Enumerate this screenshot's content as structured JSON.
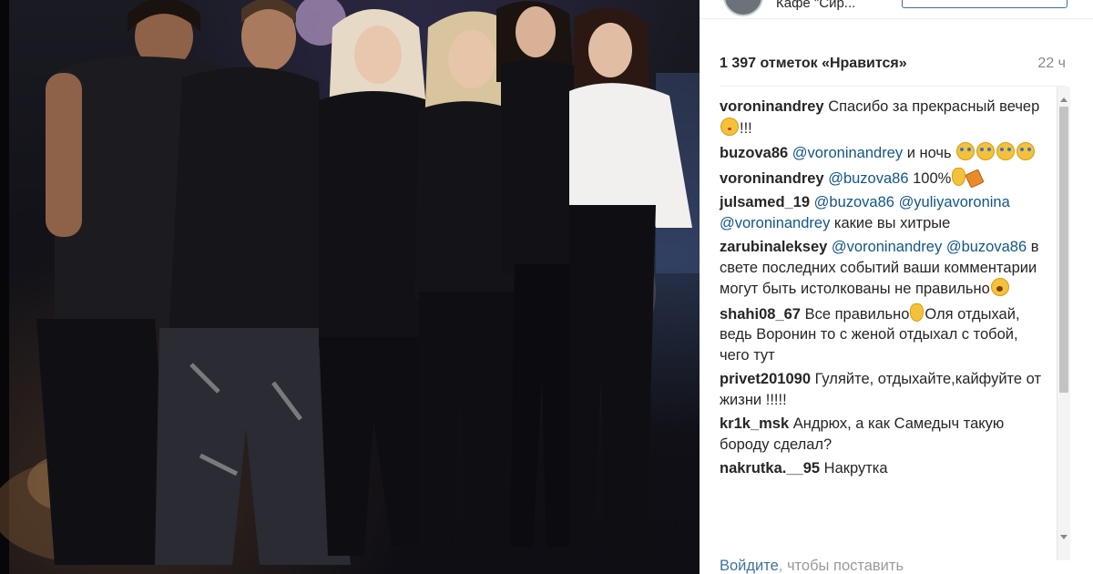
{
  "post": {
    "location": "Кафе \"Сир...",
    "likes_text": "1 397 отметок «Нравится»",
    "time_ago": "22 ч"
  },
  "comments": [
    {
      "user": "voroninandrey",
      "parts": [
        {
          "t": "text",
          "v": "Спасибо за прекрасный вечер"
        },
        {
          "t": "emoji",
          "v": "kiss"
        },
        {
          "t": "text",
          "v": "!!!"
        }
      ]
    },
    {
      "user": "buzova86",
      "parts": [
        {
          "t": "mention",
          "v": "@voroninandrey"
        },
        {
          "t": "text",
          "v": " и ночь "
        },
        {
          "t": "emoji",
          "v": "cry"
        },
        {
          "t": "emoji",
          "v": "cry"
        },
        {
          "t": "emoji",
          "v": "cry"
        },
        {
          "t": "emoji",
          "v": "cry"
        }
      ]
    },
    {
      "user": "voroninandrey",
      "parts": [
        {
          "t": "mention",
          "v": "@buzova86"
        },
        {
          "t": "text",
          "v": " 100%"
        },
        {
          "t": "emoji",
          "v": "ok"
        },
        {
          "t": "emoji",
          "v": "party"
        }
      ]
    },
    {
      "user": "julsamed_19",
      "parts": [
        {
          "t": "mention",
          "v": "@buzova86"
        },
        {
          "t": "text",
          "v": " "
        },
        {
          "t": "mention",
          "v": "@yuliyavoronina"
        },
        {
          "t": "text",
          "v": " "
        },
        {
          "t": "mention",
          "v": "@voroninandrey"
        },
        {
          "t": "text",
          "v": " какие вы хитрые"
        }
      ]
    },
    {
      "user": "zarubinaleksey",
      "parts": [
        {
          "t": "mention",
          "v": "@voroninandrey"
        },
        {
          "t": "text",
          "v": " "
        },
        {
          "t": "mention",
          "v": "@buzova86"
        },
        {
          "t": "text",
          "v": " в свете последних событий ваши комментарии могут быть истолкованы не правильно"
        },
        {
          "t": "emoji",
          "v": "scream"
        }
      ]
    },
    {
      "user": "shahi08_67",
      "parts": [
        {
          "t": "text",
          "v": "Все правильно"
        },
        {
          "t": "emoji",
          "v": "ok"
        },
        {
          "t": "text",
          "v": "Оля отдыхай, ведь Воронин то с женой отдыхал с тобой, чего тут"
        }
      ]
    },
    {
      "user": "privet201090",
      "parts": [
        {
          "t": "text",
          "v": "Гуляйте, отдыхайте,кайфуйте от жизни !!!!!"
        }
      ]
    },
    {
      "user": "kr1k_msk",
      "parts": [
        {
          "t": "text",
          "v": "Андрюх, а как Самедыч такую бороду сделал?"
        }
      ]
    },
    {
      "user": "nakrutka.__95",
      "parts": [
        {
          "t": "text",
          "v": "Накрутка"
        }
      ]
    }
  ],
  "footer": {
    "login_link": "Войдите",
    "login_rest": ", чтобы поставить"
  },
  "icons": {
    "avatar": "profile-avatar",
    "emoji_kiss": "face-blowing-kiss-icon",
    "emoji_cry": "face-tears-of-joy-icon",
    "emoji_ok": "ok-hand-icon",
    "emoji_party": "party-popper-icon",
    "emoji_scream": "face-screaming-icon"
  },
  "colors": {
    "mention": "#125688",
    "login_link": "#3f729b",
    "text": "#262626",
    "muted": "#8a8a8a"
  }
}
